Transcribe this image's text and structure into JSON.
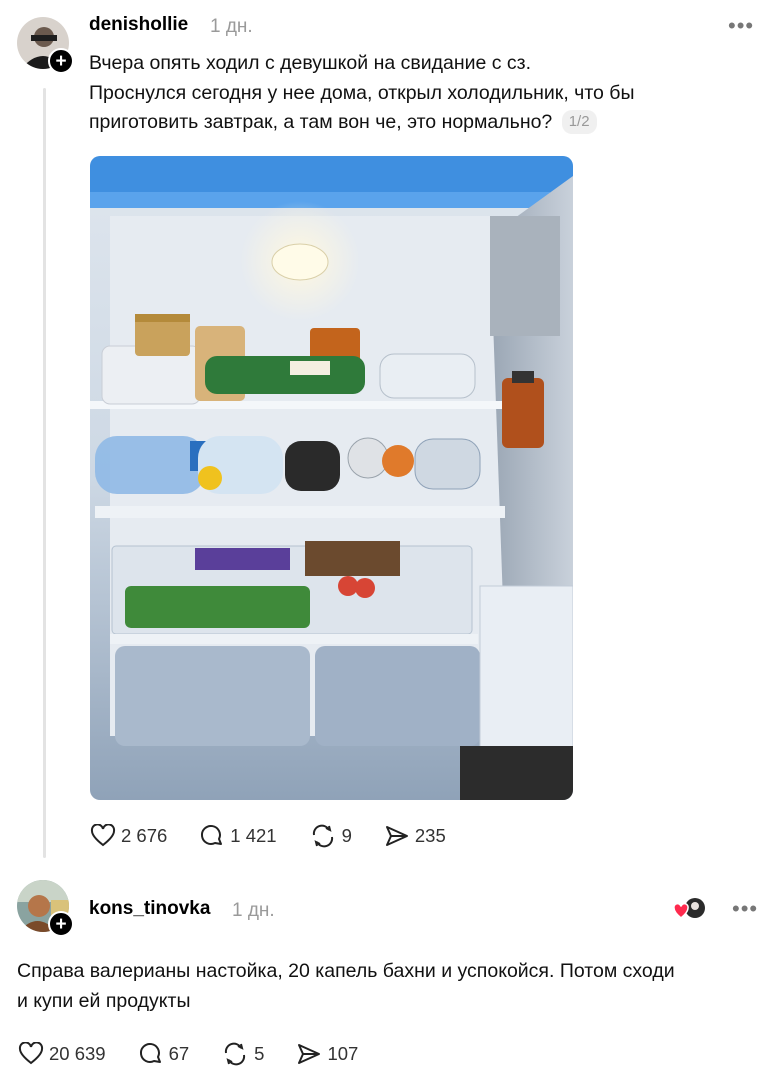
{
  "post": {
    "username": "denishollie",
    "time": "1 дн.",
    "text_lines": [
      "Вчера опять ходил с девушкой на свидание с сз.",
      "Проснулся сегодня у нее дома, открыл холодильник, что бы",
      "приготовить завтрак, а там вон че, это нормально?"
    ],
    "page_indicator": "1/2",
    "stats": {
      "likes": "2 676",
      "comments": "1 421",
      "reposts": "9",
      "shares": "235"
    }
  },
  "reply": {
    "username": "kons_tinovka",
    "time": "1 дн.",
    "text_lines": [
      "Справа валерианы настойка, 20 капель бахни и успокойся. Потом сходи",
      "и купи ей продукты"
    ],
    "stats": {
      "likes": "20 639",
      "comments": "67",
      "reposts": "5",
      "shares": "107"
    }
  },
  "icons": [
    "more-icon",
    "follow-plus-icon",
    "heart-icon",
    "comment-icon",
    "repost-icon",
    "share-icon"
  ]
}
